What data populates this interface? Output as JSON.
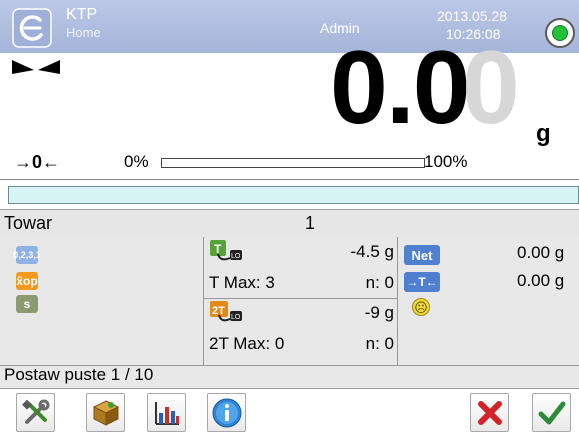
{
  "header": {
    "title": "KTP",
    "subtitle": "Home",
    "user": "Admin",
    "date": "2013.05.28",
    "time": "10:26:08"
  },
  "weight": {
    "value_main": "0.0",
    "value_ghost": "0",
    "unit": "g",
    "zero_symbol": "→0←",
    "bar_min": "0%",
    "bar_max": "100%",
    "bar_fill_fraction": 0.0
  },
  "product": {
    "label": "Towar",
    "value": "1"
  },
  "stats": {
    "icon_sum": "0,2,3,1",
    "icon_mean": "x̄op",
    "icon_s": "s",
    "tare1_value": "-4.5 g",
    "tare1_max": "T Max: 3",
    "tare1_n": "n: 0",
    "tare2_value": "-9 g",
    "tare2_max": "2T Max: 0",
    "tare2_n": "n: 0",
    "net_label": "Net",
    "net_value": "0.00 g",
    "tare_label": "→T←",
    "tare_value": "0.00 g",
    "smiley": "☹"
  },
  "message": "Postaw puste 1 / 10",
  "toolbar": {
    "icons": [
      "tools-icon",
      "package-icon",
      "chart-icon",
      "info-icon",
      "cancel-icon",
      "confirm-icon"
    ]
  },
  "colors": {
    "header": "#a5b4d9",
    "strip": "#d5f4f3",
    "panel": "#e8e8e8",
    "status_green": "#23c23b",
    "cancel_red": "#d2232a",
    "confirm_green": "#2e8b3a"
  }
}
